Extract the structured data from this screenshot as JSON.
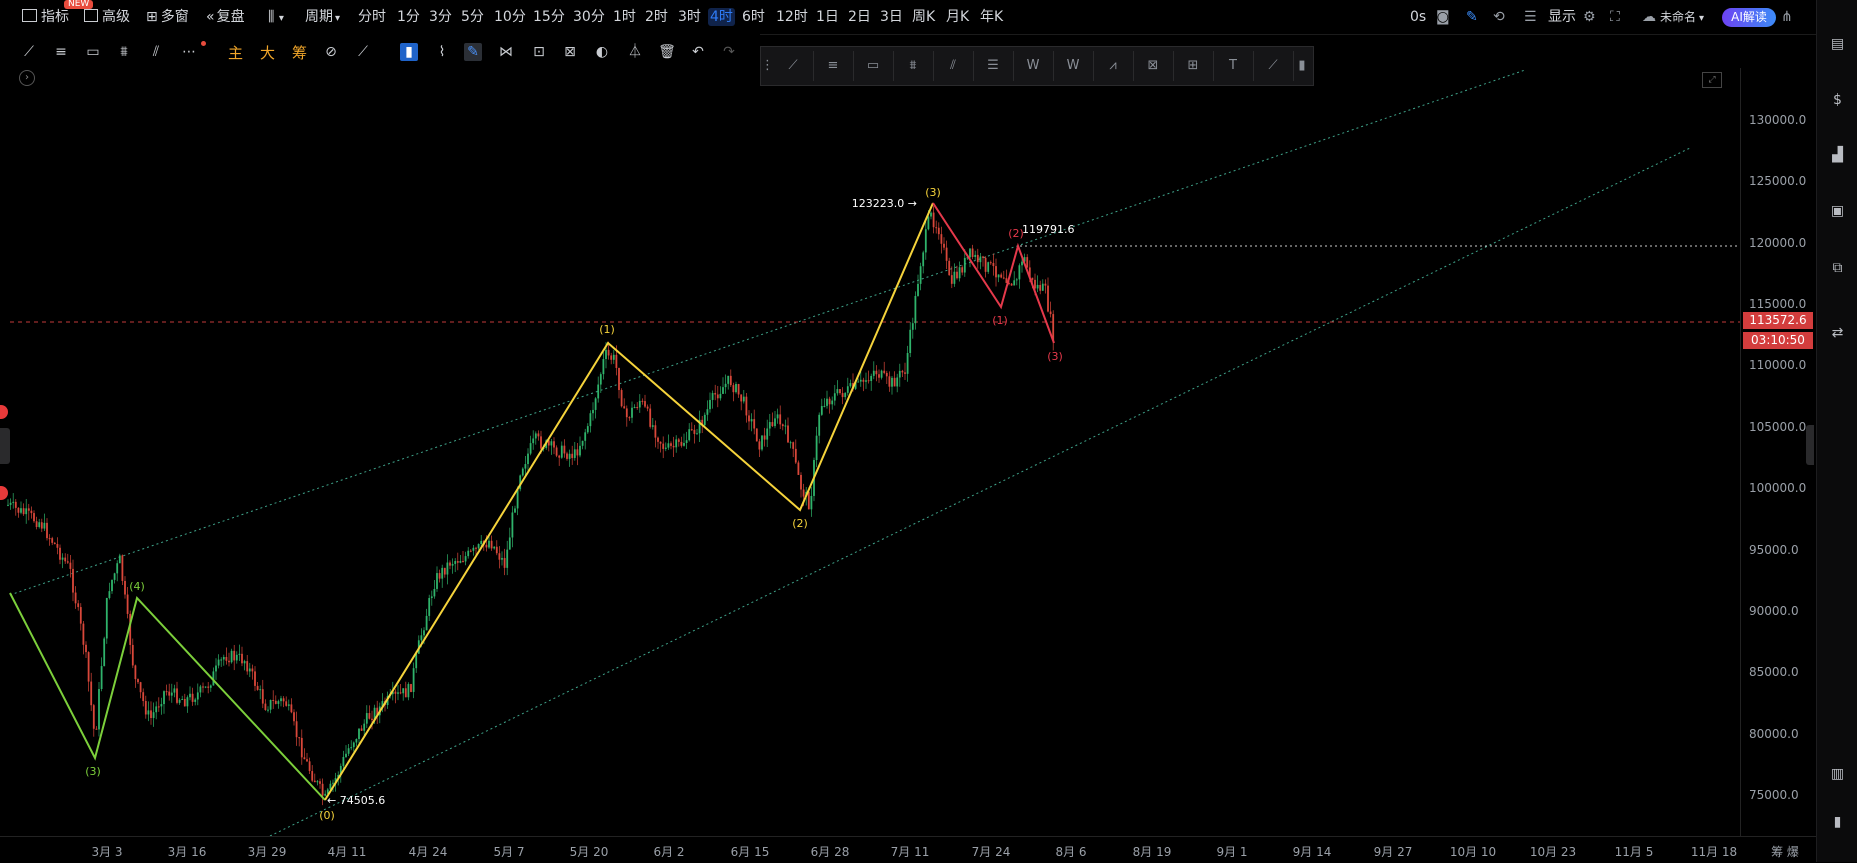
{
  "topbar": {
    "badge": "NEW",
    "indicator": "指标",
    "advanced": "高级",
    "multi_window": "多窗",
    "replay": "复盘",
    "period": "周期",
    "timeframes": [
      "分时",
      "1分",
      "3分",
      "5分",
      "10分",
      "15分",
      "30分",
      "1时",
      "2时",
      "3时",
      "4时",
      "6时",
      "12时",
      "1日",
      "2日",
      "3日",
      "周K",
      "月K",
      "年K"
    ],
    "active_timeframe": "4时",
    "latency": "0s",
    "display": "显示",
    "layout_name": "未命名",
    "ai_button": "AI解读"
  },
  "drawbar": {
    "main": "主",
    "big": "大",
    "chip": "筹"
  },
  "chart": {
    "y_ticks": [
      "130000.0",
      "125000.0",
      "120000.0",
      "115000.0",
      "110000.0",
      "105000.0",
      "100000.0",
      "95000.0",
      "90000.0",
      "85000.0",
      "80000.0",
      "75000.0"
    ],
    "x_ticks": [
      "3月 3",
      "3月 16",
      "3月 29",
      "4月 11",
      "4月 24",
      "5月 7",
      "5月 20",
      "6月 2",
      "6月 15",
      "6月 28",
      "7月 11",
      "7月 24",
      "8月 6",
      "8月 19",
      "9月 1",
      "9月 14",
      "9月 27",
      "10月 10",
      "10月 23",
      "11月 5",
      "11月 18"
    ],
    "x_right": "筹 爆",
    "current_price": "113572.6",
    "countdown": "03:10:50",
    "high_label": "123223.0",
    "low_label": "74505.6",
    "level_label": "119791.6",
    "wave_labels": {
      "w0": "(0)",
      "w1": "(1)",
      "w2": "(2)",
      "w3": "(3)",
      "g3": "(3)",
      "g4": "(4)",
      "r1": "(1)",
      "r2": "(2)",
      "r3": "(3)"
    },
    "colors": {
      "yellow": "#f5d33b",
      "green": "#7ccf3b",
      "red": "#e5394b",
      "up": "#d9473a",
      "down": "#2fb36b"
    }
  }
}
